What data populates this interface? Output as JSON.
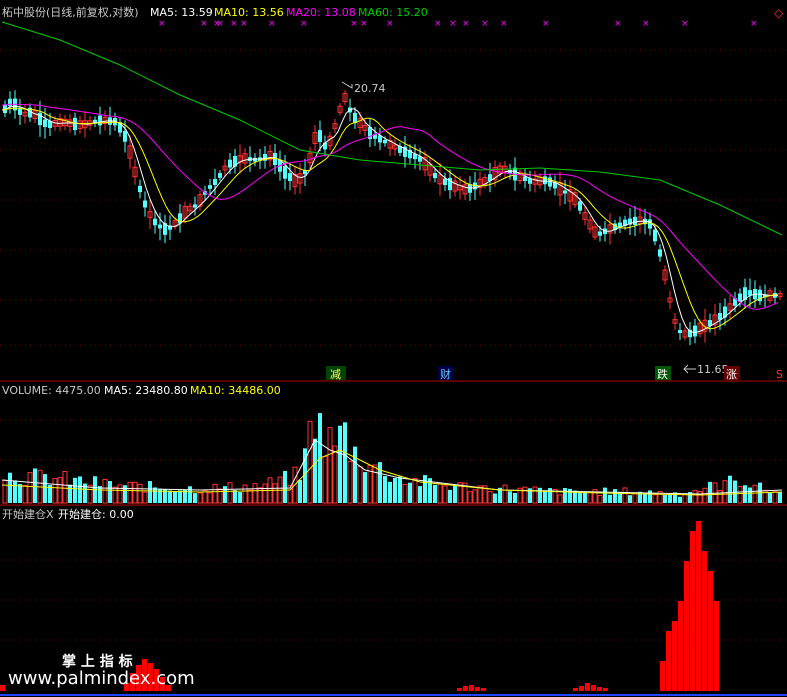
{
  "header": {
    "stock": "柘中股份(日线,前复权,对数)",
    "ma5": "MA5: 13.59",
    "ma10": "MA10: 13.56",
    "ma20": "MA20: 13.08",
    "ma60": "MA60: 15.20"
  },
  "volume_header": {
    "label": "VOLUME: 4475.00",
    "ma5": "MA5: 23480.80",
    "ma10": "MA10: 34486.00"
  },
  "indicator_header": {
    "label": "开始建仓X",
    "value": "开始建仓: 0.00"
  },
  "annotations": {
    "high": "20.74",
    "low": "11.65"
  },
  "tags": {
    "jian": "减",
    "cai": "财",
    "die": "跌",
    "zhang": "涨",
    "s": "S"
  },
  "watermark": {
    "brand": "掌 上 指 标",
    "url": "www.palmindex.com"
  },
  "colors": {
    "up": "#ff3232",
    "down": "#54ffff",
    "ma5": "#ffffff",
    "ma10": "#ffff00",
    "ma20": "#ff00ff",
    "ma60": "#00cc00",
    "divider": "#b00000",
    "indicator": "#ff0000"
  },
  "chart_data": [
    {
      "type": "candlestick",
      "title": "柘中股份(日线,前复权,对数)",
      "log_scale": true,
      "series": [
        {
          "name": "MA5",
          "last": 13.59
        },
        {
          "name": "MA10",
          "last": 13.56
        },
        {
          "name": "MA20",
          "last": 13.08
        },
        {
          "name": "MA60",
          "last": 15.2
        }
      ],
      "high_marker": 20.74,
      "low_marker": 11.65
    },
    {
      "type": "bar",
      "title": "VOLUME",
      "last_value": 4475.0,
      "series": [
        {
          "name": "MA5",
          "last": 23480.8
        },
        {
          "name": "MA10",
          "last": 34486.0
        }
      ]
    },
    {
      "type": "bar",
      "title": "开始建仓X",
      "last_value": 0.0
    }
  ]
}
